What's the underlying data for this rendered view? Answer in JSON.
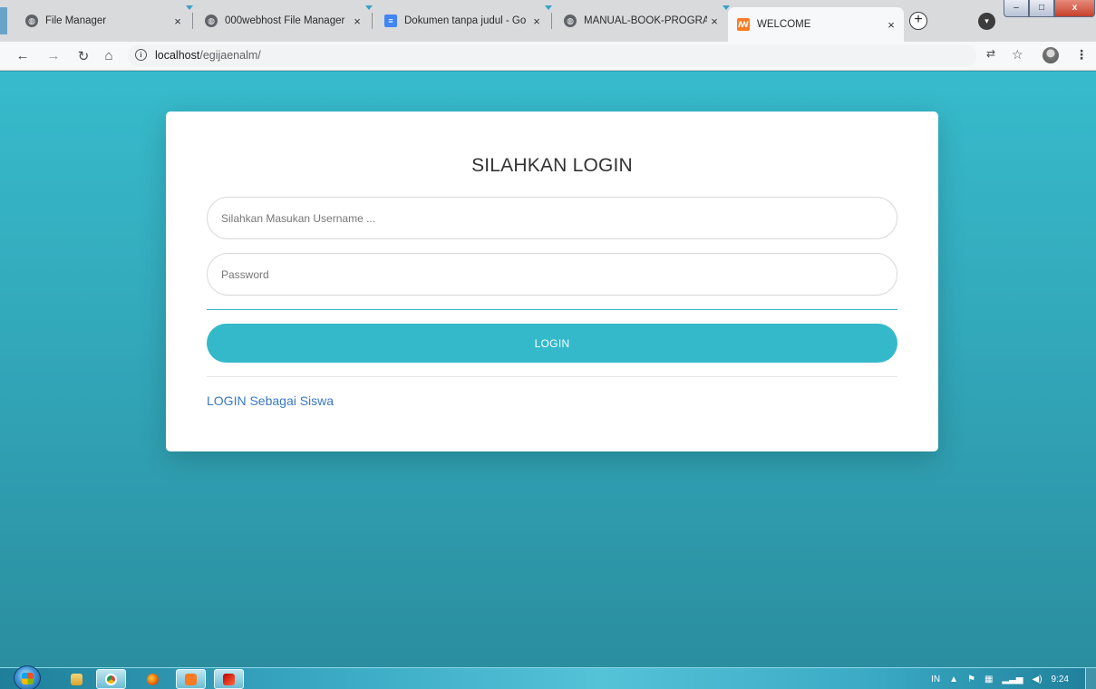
{
  "browser": {
    "tabs": [
      {
        "title": "File Manager",
        "icon": "globe-icon"
      },
      {
        "title": "000webhost File Manager",
        "icon": "globe-icon"
      },
      {
        "title": "Dokumen tanpa judul - Go",
        "icon": "docs-icon"
      },
      {
        "title": "MANUAL-BOOK-PROGRAI",
        "icon": "globe-icon"
      },
      {
        "title": "WELCOME",
        "icon": "xampp-icon"
      }
    ],
    "active_tab_index": 4,
    "close_glyph": "×",
    "new_tab_glyph": "+",
    "url": {
      "host": "localhost",
      "path": "/egijaenalm/"
    },
    "window_buttons": {
      "minimize": "–",
      "maximize": "□",
      "close": "x"
    }
  },
  "login": {
    "title": "SILAHKAN LOGIN",
    "username_placeholder": "Silahkan Masukan Username ...",
    "password_placeholder": "Password",
    "submit_label": "LOGIN",
    "student_link": "LOGIN Sebagai Siswa"
  },
  "taskbar": {
    "pinned": [
      "explorer-icon",
      "chrome-icon",
      "firefox-icon",
      "xampp-icon",
      "filezilla-icon"
    ],
    "tray": {
      "language": "IN",
      "clock": "9:24"
    }
  },
  "colors": {
    "page_background": "#37bbcc",
    "accent": "#34b9cb",
    "link": "#3a78c3"
  }
}
